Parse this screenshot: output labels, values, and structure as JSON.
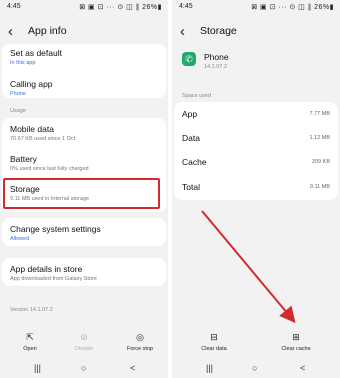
{
  "left": {
    "status_time": "4:45",
    "status_icons": "⊠ ▣ ⊡ ··· ⊙ ◫ ∥ 26%▮",
    "title": "App info",
    "items": [
      {
        "title": "Set as default",
        "sub": "In this app"
      },
      {
        "title": "Calling app",
        "sub": "Phone"
      }
    ],
    "usage_label": "Usage",
    "usage_items": [
      {
        "title": "Mobile data",
        "sub": "70.67 KB used since 1 Oct"
      },
      {
        "title": "Battery",
        "sub": "0% used since last fully charged"
      },
      {
        "title": "Storage",
        "sub": "9.11 MB used in Internal storage"
      }
    ],
    "change_settings": {
      "title": "Change system settings",
      "sub": "Allowed"
    },
    "store": {
      "title": "App details in store",
      "sub": "App downloaded from Galaxy Store"
    },
    "version": "Version 14.1.07.2",
    "actions": [
      {
        "label": "Open",
        "icon": "open-icon"
      },
      {
        "label": "Disable",
        "icon": "disable-icon"
      },
      {
        "label": "Force stop",
        "icon": "force-stop-icon"
      }
    ]
  },
  "right": {
    "status_time": "4:45",
    "status_icons": "⊠ ▣ ⊡ ··· ⊙ ◫ ∥ 26%▮",
    "title": "Storage",
    "app_name": "Phone",
    "app_version": "14.1.07.2",
    "space_label": "Space used",
    "rows": [
      {
        "label": "App",
        "value": "7.77 MB"
      },
      {
        "label": "Data",
        "value": "1.12 MB"
      },
      {
        "label": "Cache",
        "value": "209 KB"
      }
    ],
    "total": {
      "label": "Total",
      "value": "9.11 MB"
    },
    "actions": [
      {
        "label": "Clear data",
        "icon": "clear-data-icon"
      },
      {
        "label": "Clear cache",
        "icon": "clear-cache-icon"
      }
    ]
  },
  "nav": {
    "recents": "|||",
    "home": "○",
    "back": "<"
  },
  "colors": {
    "highlight": "#d32a2f",
    "accent": "#3d6fd6",
    "phone_app": "#23a86d"
  }
}
